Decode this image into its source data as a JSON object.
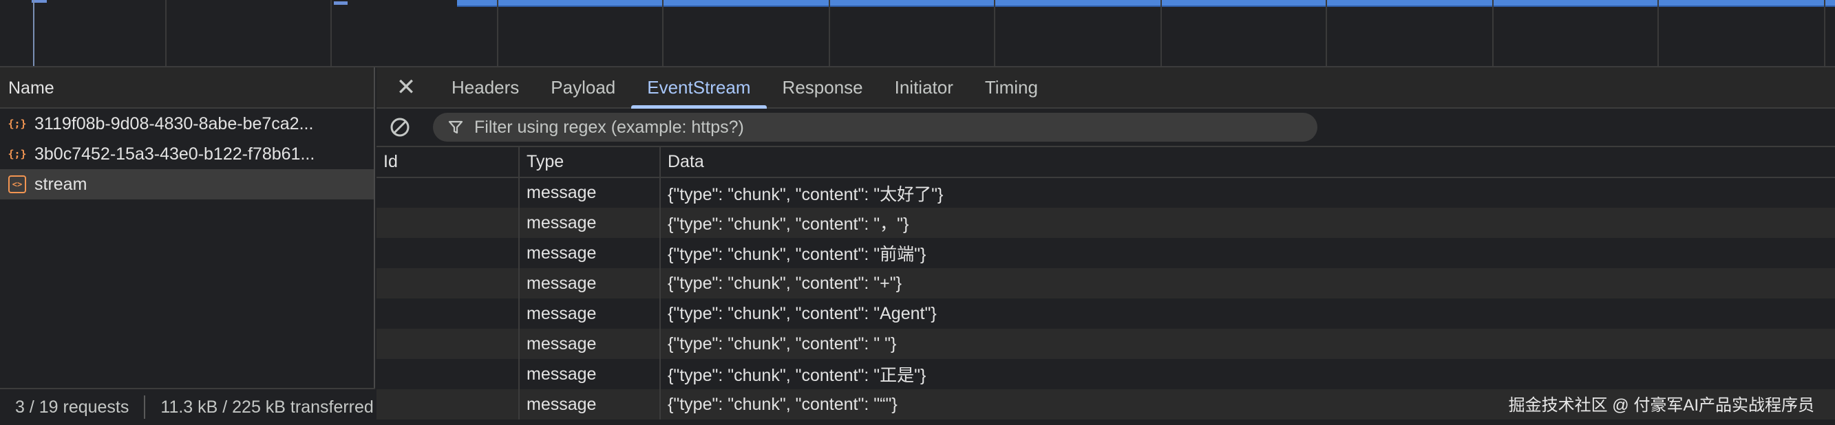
{
  "network": {
    "list_header": "Name",
    "requests": [
      {
        "icon": "json-icon",
        "icon_glyph": "{;}",
        "name": "3119f08b-9d08-4830-8abe-be7ca2..."
      },
      {
        "icon": "json-icon",
        "icon_glyph": "{;}",
        "name": "3b0c7452-15a3-43e0-b122-f78b61..."
      },
      {
        "icon": "document-icon",
        "icon_glyph": "<>",
        "name": "stream"
      }
    ],
    "status": {
      "requests": "3 / 19 requests",
      "transferred": "11.3 kB / 225 kB transferred"
    }
  },
  "detail": {
    "close_glyph": "✕",
    "tabs": [
      {
        "label": "Headers"
      },
      {
        "label": "Payload"
      },
      {
        "label": "EventStream"
      },
      {
        "label": "Response"
      },
      {
        "label": "Initiator"
      },
      {
        "label": "Timing"
      }
    ],
    "active_tab": "EventStream",
    "filter_placeholder": "Filter using regex (example: https?)",
    "columns": [
      "Id",
      "Type",
      "Data"
    ],
    "events": [
      {
        "id": "",
        "type": "message",
        "data": "{\"type\": \"chunk\", \"content\": \"太好了\"}"
      },
      {
        "id": "",
        "type": "message",
        "data": "{\"type\": \"chunk\", \"content\": \"，\"}"
      },
      {
        "id": "",
        "type": "message",
        "data": "{\"type\": \"chunk\", \"content\": \"前端\"}"
      },
      {
        "id": "",
        "type": "message",
        "data": "{\"type\": \"chunk\", \"content\": \"+\"}"
      },
      {
        "id": "",
        "type": "message",
        "data": "{\"type\": \"chunk\", \"content\": \"Agent\"}"
      },
      {
        "id": "",
        "type": "message",
        "data": "{\"type\": \"chunk\", \"content\": \" \"}"
      },
      {
        "id": "",
        "type": "message",
        "data": "{\"type\": \"chunk\", \"content\": \"正是\"}"
      },
      {
        "id": "",
        "type": "message",
        "data": "{\"type\": \"chunk\", \"content\": \"“\"}"
      }
    ]
  },
  "watermark": "掘金技术社区 @ 付豪军AI产品实战程序员",
  "colors": {
    "background": "#202124",
    "accent": "#a8c7fa",
    "waterfall": "#4d86db",
    "json_icon": "#f29552"
  }
}
